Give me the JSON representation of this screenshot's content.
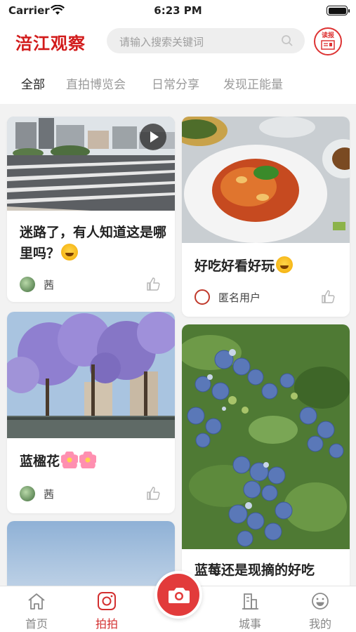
{
  "status": {
    "carrier": "Carrier",
    "time": "6:23 PM"
  },
  "header": {
    "logo_text": "涪江观察",
    "search_placeholder": "请输入搜索关键词",
    "paper_label_top": "读报"
  },
  "tabs": [
    "全部",
    "直拍博览会",
    "日常分享",
    "发现正能量"
  ],
  "feed": {
    "left": [
      {
        "title": "迷路了，有人知道这是哪里吗？",
        "author": "茜",
        "has_video": true
      },
      {
        "title": "蓝楹花",
        "author": "茜"
      },
      {
        "title": ""
      }
    ],
    "right": [
      {
        "title": "好吃好看好玩",
        "author": "匿名用户"
      },
      {
        "title": "蓝莓还是现摘的好吃"
      }
    ]
  },
  "tabbar": {
    "items": [
      "首页",
      "拍拍",
      "城事",
      "我的"
    ],
    "active": "拍拍"
  },
  "colors": {
    "brand_red": "#d21b1b",
    "accent": "#e23b3b"
  }
}
